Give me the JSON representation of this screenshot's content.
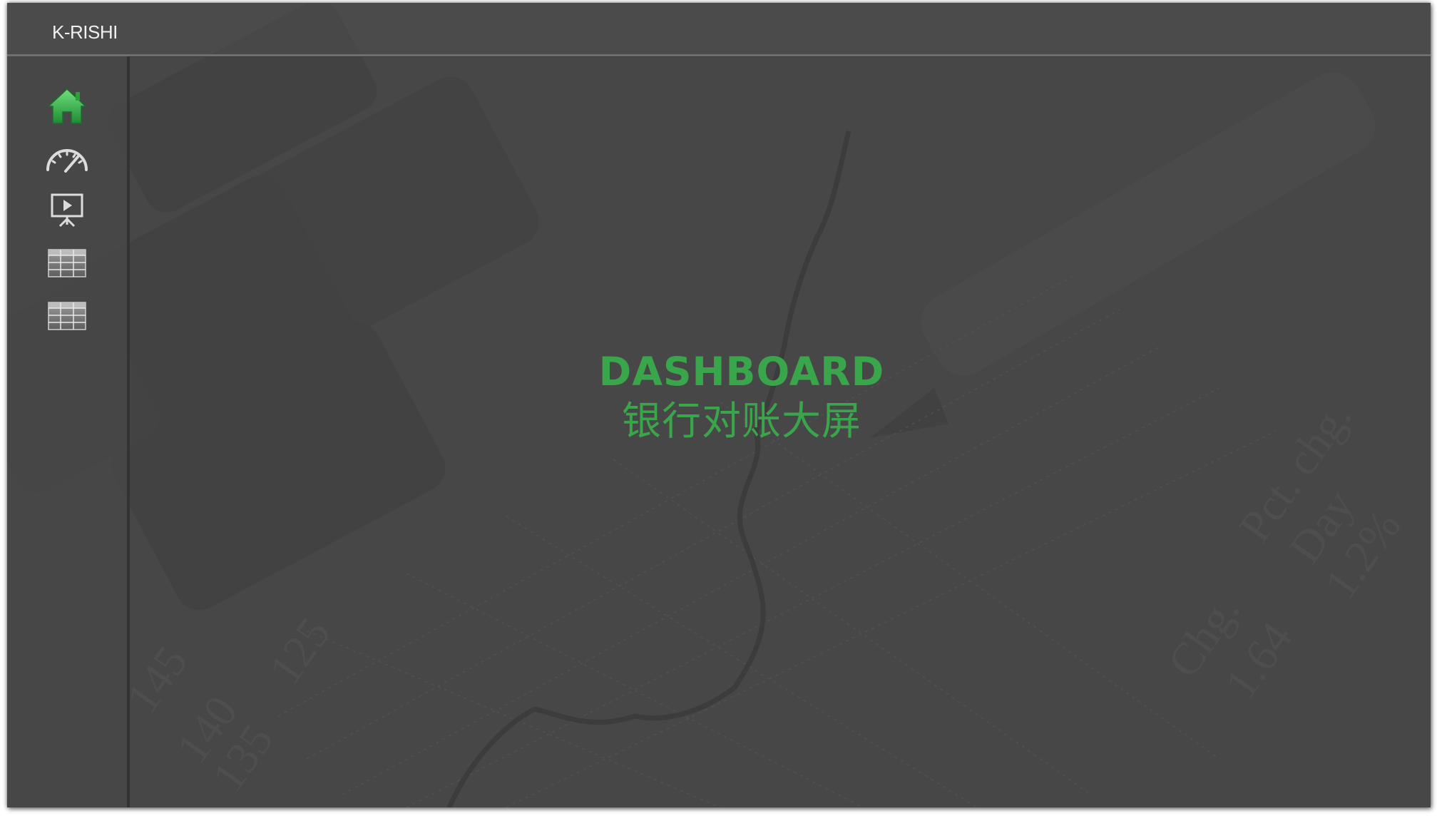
{
  "app": {
    "title": "K-RISHI"
  },
  "sidebar": {
    "items": [
      {
        "icon": "home-icon",
        "label": "Home",
        "active": true
      },
      {
        "icon": "speedometer-icon",
        "label": "Gauge"
      },
      {
        "icon": "presentation-icon",
        "label": "Presentation"
      },
      {
        "icon": "table-icon",
        "label": "Table 1"
      },
      {
        "icon": "table-icon",
        "label": "Table 2"
      }
    ]
  },
  "main": {
    "heading": "DASHBOARD",
    "subheading": "银行对账大屏"
  },
  "colors": {
    "accent": "#3aa64b",
    "background": "#474747",
    "icon": "#dcdcdc"
  }
}
